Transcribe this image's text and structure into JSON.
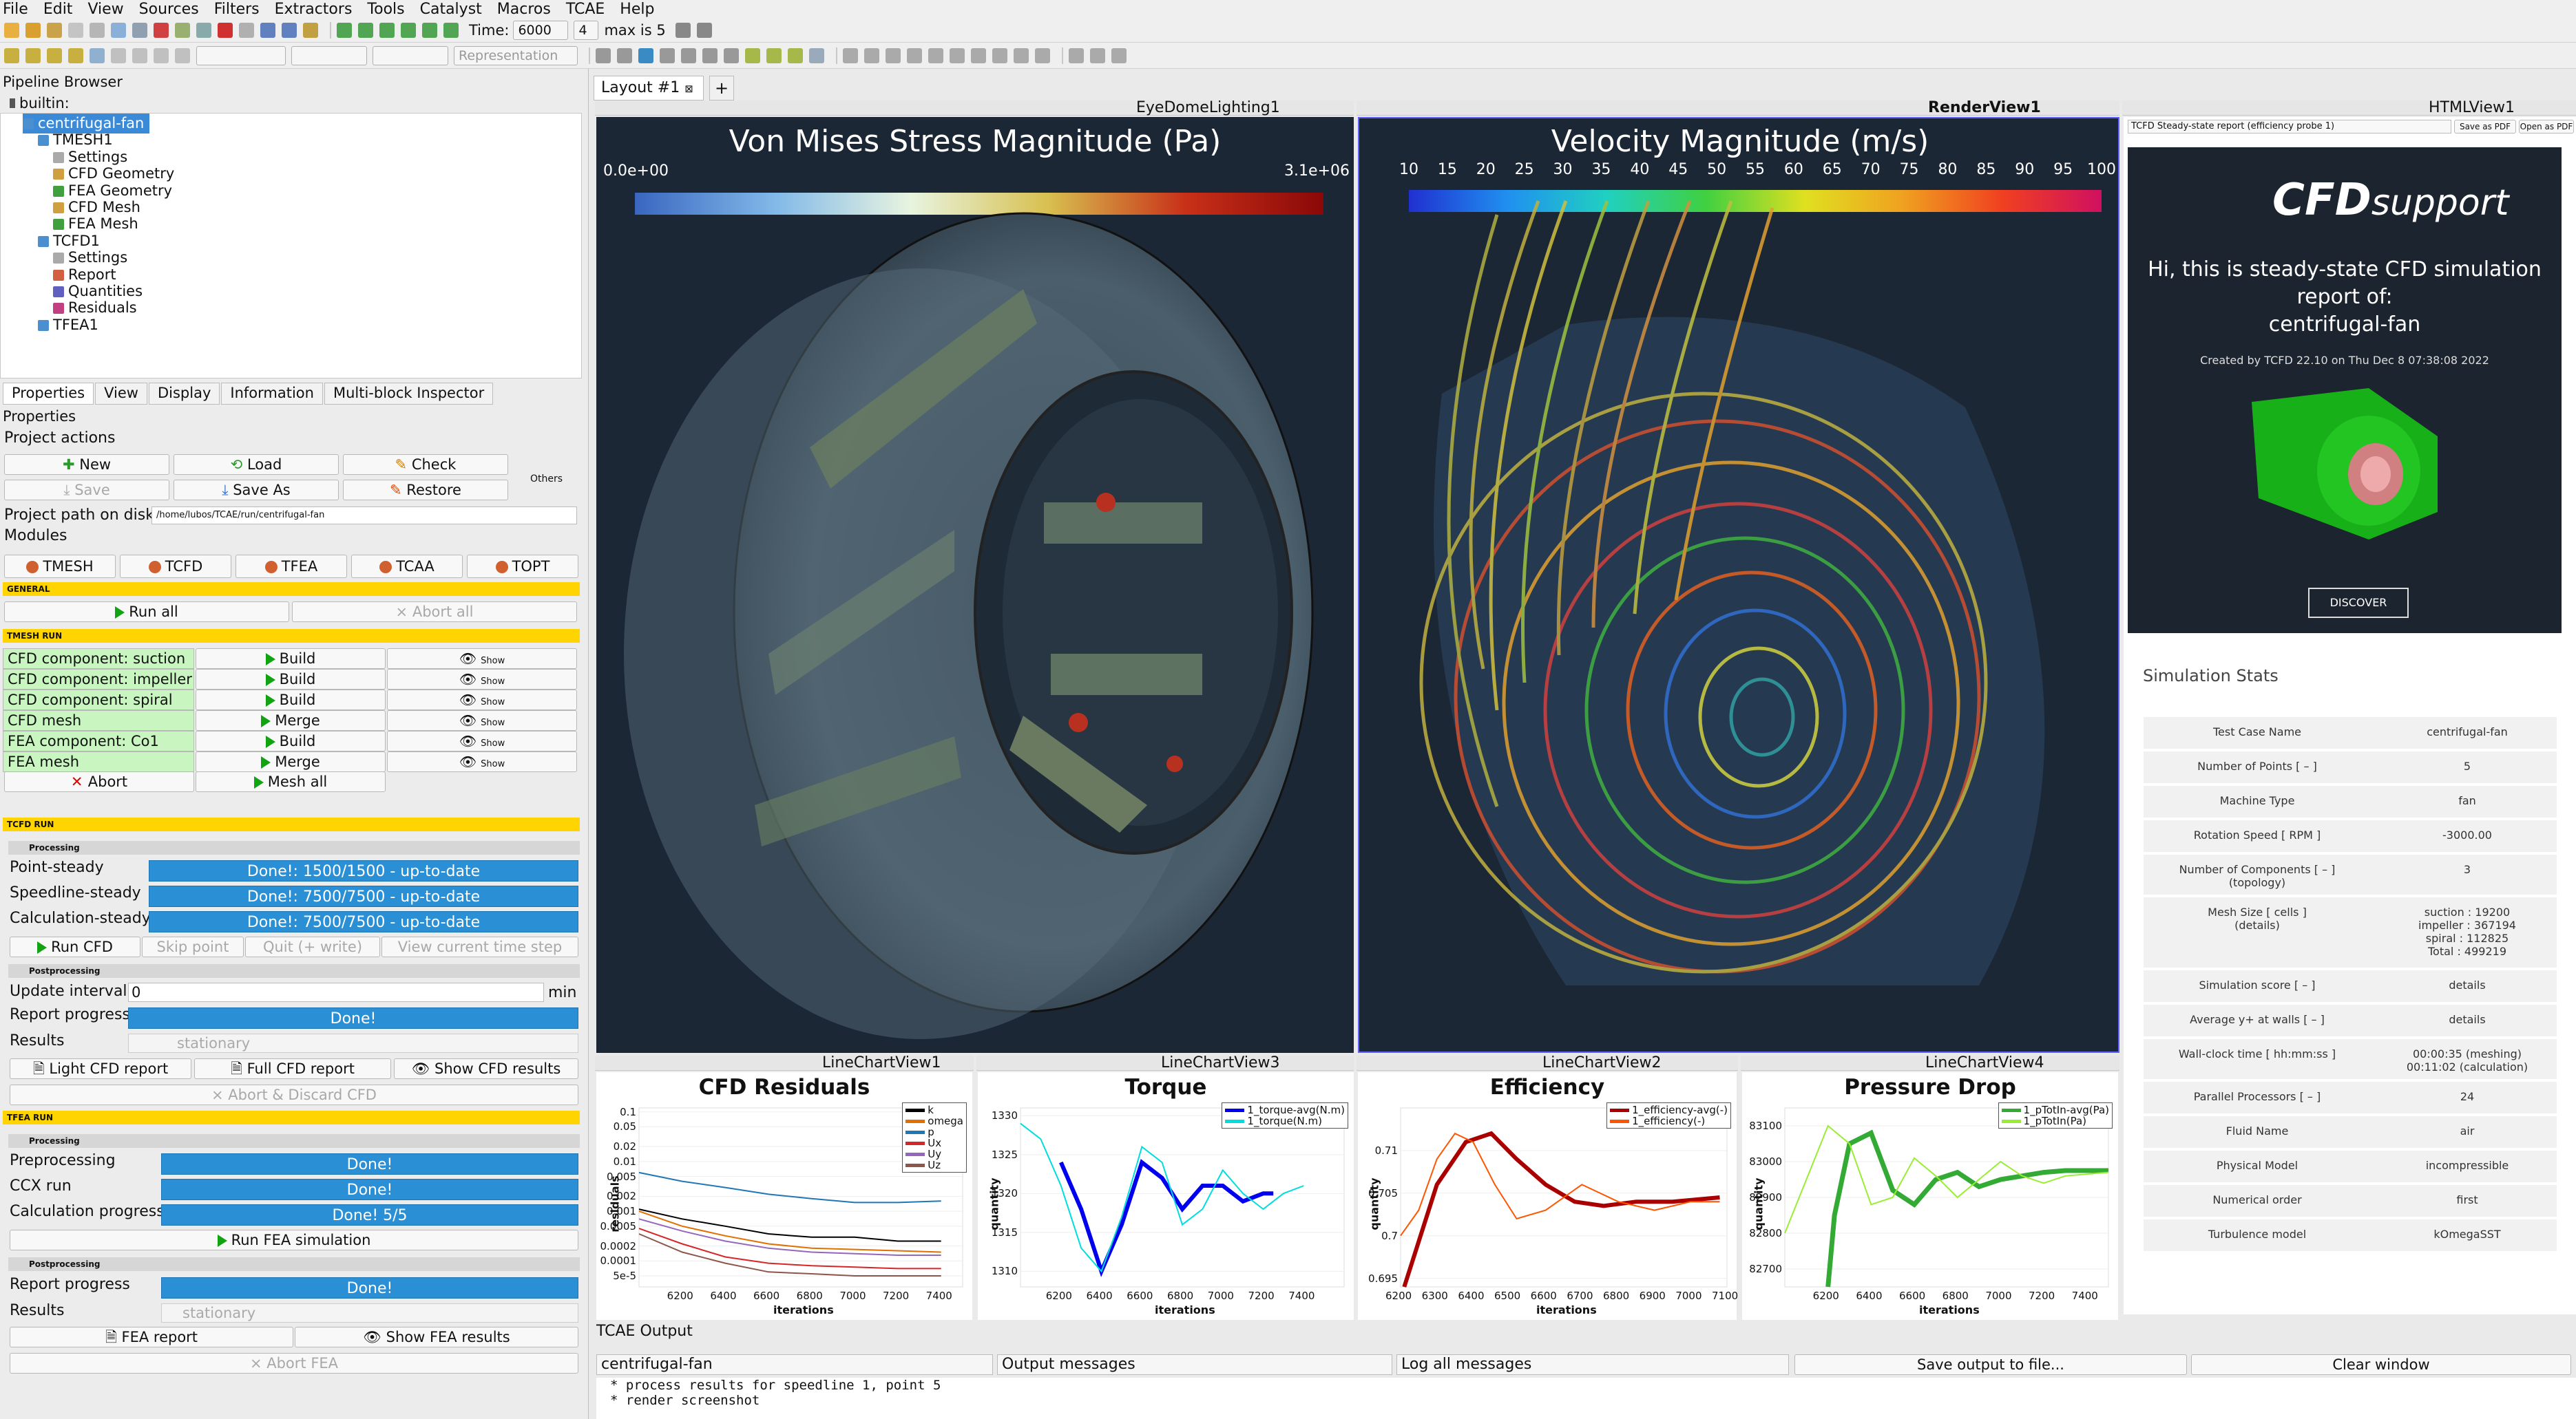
{
  "menu": [
    "File",
    "Edit",
    "View",
    "Sources",
    "Filters",
    "Extractors",
    "Tools",
    "Catalyst",
    "Macros",
    "TCAE",
    "Help"
  ],
  "toolbar": {
    "time_label": "Time:",
    "time_value": "6000",
    "step_value": "4",
    "max_text": "max is 5",
    "representation": "Representation"
  },
  "pipeline": {
    "title": "Pipeline Browser",
    "root": "builtin:",
    "items": [
      {
        "label": "centrifugal-fan",
        "indent": 1,
        "sel": true
      },
      {
        "label": "TMESH1",
        "indent": 2
      },
      {
        "label": "Settings",
        "indent": 3
      },
      {
        "label": "CFD Geometry",
        "indent": 3
      },
      {
        "label": "FEA Geometry",
        "indent": 3
      },
      {
        "label": "CFD Mesh",
        "indent": 3
      },
      {
        "label": "FEA Mesh",
        "indent": 3
      },
      {
        "label": "TCFD1",
        "indent": 2
      },
      {
        "label": "Settings",
        "indent": 3
      },
      {
        "label": "Report",
        "indent": 3
      },
      {
        "label": "Quantities",
        "indent": 3
      },
      {
        "label": "Residuals",
        "indent": 3
      },
      {
        "label": "TFEA1",
        "indent": 2
      }
    ]
  },
  "proptabs": [
    "Properties",
    "View",
    "Display",
    "Information",
    "Multi-block Inspector"
  ],
  "props": {
    "title": "Properties",
    "project_actions": "Project actions",
    "new": "New",
    "load": "Load",
    "check": "Check",
    "save": "Save",
    "save_as": "Save As",
    "restore": "Restore",
    "others": "Others",
    "path_label": "Project path on disk",
    "path_value": "/home/lubos/TCAE/run/centrifugal-fan",
    "modules_label": "Modules",
    "modules": [
      "TMESH",
      "TCFD",
      "TFEA",
      "TCAA",
      "TOPT"
    ],
    "general": "GENERAL",
    "run_all": "Run all",
    "abort_all": "Abort all",
    "tmesh_run": "TMESH RUN",
    "tmesh_rows": [
      {
        "label": "CFD component: suction",
        "action": "Build",
        "show": "Show"
      },
      {
        "label": "CFD component: impeller",
        "action": "Build",
        "show": "Show"
      },
      {
        "label": "CFD component: spiral",
        "action": "Build",
        "show": "Show"
      },
      {
        "label": "CFD mesh",
        "action": "Merge",
        "show": "Show"
      },
      {
        "label": "FEA component: Co1",
        "action": "Build",
        "show": "Show"
      },
      {
        "label": "FEA mesh",
        "action": "Merge",
        "show": "Show"
      }
    ],
    "abort": "Abort",
    "mesh_all": "Mesh all",
    "tcfd_run": "TCFD RUN",
    "processing": "Processing",
    "cfd_progress": [
      {
        "label": "Point-steady",
        "value": "Done!: 1500/1500 - up-to-date"
      },
      {
        "label": "Speedline-steady",
        "value": "Done!: 7500/7500 - up-to-date"
      },
      {
        "label": "Calculation-steady",
        "value": "Done!: 7500/7500 - up-to-date"
      }
    ],
    "run_cfd": "Run CFD",
    "skip_point": "Skip point",
    "quit_write": "Quit (+ write)",
    "view_time_step": "View current time step",
    "postprocessing": "Postprocessing",
    "update_interval": "Update interval",
    "update_value": "0",
    "update_unit": "min",
    "report_progress": "Report progress",
    "done": "Done!",
    "results": "Results",
    "results_value": "stationary",
    "light_cfd": "Light CFD report",
    "full_cfd": "Full CFD report",
    "show_cfd": "Show CFD results",
    "abort_discard": "Abort & Discard CFD",
    "tfea_run": "TFEA RUN",
    "fea_rows": [
      {
        "label": "Preprocessing",
        "value": "Done!"
      },
      {
        "label": "CCX run",
        "value": "Done!"
      },
      {
        "label": "Calculation progress",
        "value": "Done! 5/5"
      }
    ],
    "run_fea": "Run FEA simulation",
    "fea_report": "FEA report",
    "show_fea": "Show FEA results",
    "abort_fea": "Abort FEA"
  },
  "layout_tab": "Layout #1",
  "views": {
    "v1": "EyeDomeLighting1",
    "v2": "RenderView1",
    "v3": "HTMLView1",
    "l1": "LineChartView1",
    "l3": "LineChartView3",
    "l2": "LineChartView2",
    "l4": "LineChartView4"
  },
  "stress": {
    "title": "Von Mises Stress Magnitude (Pa)",
    "min": "0.0e+00",
    "max": "3.1e+06"
  },
  "velocity": {
    "title": "Velocity Magnitude (m/s)",
    "ticks": [
      "10",
      "15",
      "20",
      "25",
      "30",
      "35",
      "40",
      "45",
      "50",
      "55",
      "60",
      "65",
      "70",
      "75",
      "80",
      "85",
      "90",
      "95",
      "100"
    ]
  },
  "html": {
    "select": "TCFD Steady-state report (efficiency probe 1)",
    "save_pdf": "Save as PDF",
    "open_pdf": "Open as PDF",
    "brand": "CFD",
    "brand2": "support",
    "hello": "Hi, this is steady-state CFD simulation",
    "report_of": "report of:",
    "case": "centrifugal-fan",
    "created": "Created by TCFD 22.10 on Thu Dec 8 07:38:08 2022",
    "discover": "DISCOVER",
    "stats_title": "Simulation Stats",
    "stats": [
      [
        "Test Case Name",
        "centrifugal-fan"
      ],
      [
        "Number of Points [ – ]",
        "5"
      ],
      [
        "Machine Type",
        "fan"
      ],
      [
        "Rotation Speed [ RPM ]",
        "-3000.00"
      ],
      [
        "Number of Components [ – ]\n(topology)",
        "3"
      ],
      [
        "Mesh Size [ cells ]\n(details)",
        "suction : 19200\nimpeller : 367194\nspiral : 112825\nTotal : 499219"
      ],
      [
        "Simulation score [ – ]",
        "details"
      ],
      [
        "Average y+ at walls [ – ]",
        "details"
      ],
      [
        "Wall-clock time [ hh:mm:ss ]",
        "00:00:35 (meshing)\n00:11:02 (calculation)"
      ],
      [
        "Parallel Processors [ – ]",
        "24"
      ],
      [
        "Fluid Name",
        "air"
      ],
      [
        "Physical Model",
        "incompressible"
      ],
      [
        "Numerical order",
        "first"
      ],
      [
        "Turbulence model",
        "kOmegaSST"
      ]
    ]
  },
  "output": {
    "title": "TCAE Output",
    "case": "centrifugal-fan",
    "kind": "Output messages",
    "level": "Log all messages",
    "save": "Save output to file...",
    "clear": "Clear window",
    "lines": [
      "* process results for speedline 1, point 5",
      "* render screenshot"
    ]
  },
  "colors": {
    "progress": "#2a8fd4",
    "yellow": "#ffd400",
    "green_row": "#c8f5c0",
    "view_bg": "#1a2330"
  },
  "chart_data": [
    {
      "type": "line",
      "title": "CFD Residuals",
      "xlabel": "iterations",
      "ylabel": "residuals",
      "xlim": [
        6000,
        7500
      ],
      "yscale": "log",
      "xticks": [
        "6200",
        "6400",
        "6600",
        "6800",
        "7000",
        "7200",
        "7400"
      ],
      "yticks": [
        "0.1",
        "0.05",
        "0.02",
        "0.01",
        "0.005",
        "0.002",
        "0.001",
        "0.0005",
        "0.0002",
        "0.0001",
        "5e-5"
      ],
      "series": [
        {
          "name": "k",
          "color": "#000000",
          "values": [
            [
              6000,
              0.0011
            ],
            [
              6200,
              0.0007
            ],
            [
              6400,
              0.0005
            ],
            [
              6600,
              0.00035
            ],
            [
              6800,
              0.0003
            ],
            [
              7000,
              0.0003
            ],
            [
              7200,
              0.00025
            ],
            [
              7400,
              0.00025
            ]
          ]
        },
        {
          "name": "omega",
          "color": "#e07000",
          "values": [
            [
              6000,
              0.001
            ],
            [
              6200,
              0.0005
            ],
            [
              6400,
              0.00032
            ],
            [
              6600,
              0.00022
            ],
            [
              6800,
              0.00018
            ],
            [
              7000,
              0.00017
            ],
            [
              7200,
              0.00016
            ],
            [
              7400,
              0.00015
            ]
          ]
        },
        {
          "name": "p",
          "color": "#1f77b4",
          "values": [
            [
              6000,
              0.006
            ],
            [
              6200,
              0.004
            ],
            [
              6400,
              0.003
            ],
            [
              6600,
              0.0022
            ],
            [
              6800,
              0.0018
            ],
            [
              7000,
              0.0015
            ],
            [
              7200,
              0.0015
            ],
            [
              7400,
              0.0016
            ]
          ]
        },
        {
          "name": "Ux",
          "color": "#d62728",
          "values": [
            [
              6000,
              0.00045
            ],
            [
              6200,
              0.00022
            ],
            [
              6400,
              0.00012
            ],
            [
              6600,
              9e-05
            ],
            [
              6800,
              8e-05
            ],
            [
              7000,
              7.5e-05
            ],
            [
              7200,
              7e-05
            ],
            [
              7400,
              7e-05
            ]
          ]
        },
        {
          "name": "Uy",
          "color": "#9467bd",
          "values": [
            [
              6000,
              0.0007
            ],
            [
              6200,
              0.0004
            ],
            [
              6400,
              0.00025
            ],
            [
              6600,
              0.00018
            ],
            [
              6800,
              0.00015
            ],
            [
              7000,
              0.00014
            ],
            [
              7200,
              0.00013
            ],
            [
              7400,
              0.00013
            ]
          ]
        },
        {
          "name": "Uz",
          "color": "#8c564b",
          "values": [
            [
              6000,
              0.00035
            ],
            [
              6200,
              0.00015
            ],
            [
              6400,
              9e-05
            ],
            [
              6600,
              6e-05
            ],
            [
              6800,
              5.5e-05
            ],
            [
              7000,
              5e-05
            ],
            [
              7200,
              5e-05
            ],
            [
              7400,
              5e-05
            ]
          ]
        }
      ]
    },
    {
      "type": "line",
      "title": "Torque",
      "xlabel": "iterations",
      "ylabel": "quantity",
      "xlim": [
        6000,
        7600
      ],
      "ylim": [
        1308,
        1331
      ],
      "xticks": [
        "6200",
        "6400",
        "6600",
        "6800",
        "7000",
        "7200",
        "7400"
      ],
      "yticks": [
        "1330",
        "1325",
        "1320",
        "1315",
        "1310"
      ],
      "series": [
        {
          "name": "1_torque-avg(N.m)",
          "color": "#0000ee",
          "width": 6,
          "values": [
            [
              6200,
              1324
            ],
            [
              6300,
              1318
            ],
            [
              6400,
              1310
            ],
            [
              6500,
              1316
            ],
            [
              6600,
              1324
            ],
            [
              6700,
              1322
            ],
            [
              6800,
              1318
            ],
            [
              6900,
              1321
            ],
            [
              7000,
              1321
            ],
            [
              7100,
              1319
            ],
            [
              7200,
              1320
            ],
            [
              7250,
              1320
            ]
          ]
        },
        {
          "name": "1_torque(N.m)",
          "color": "#00dddd",
          "width": 2,
          "values": [
            [
              6000,
              1329
            ],
            [
              6100,
              1327
            ],
            [
              6200,
              1321
            ],
            [
              6300,
              1313
            ],
            [
              6400,
              1310
            ],
            [
              6500,
              1317
            ],
            [
              6600,
              1326
            ],
            [
              6700,
              1324
            ],
            [
              6800,
              1316
            ],
            [
              6900,
              1318
            ],
            [
              7000,
              1323
            ],
            [
              7100,
              1320
            ],
            [
              7200,
              1318
            ],
            [
              7300,
              1320
            ],
            [
              7400,
              1321
            ]
          ]
        }
      ]
    },
    {
      "type": "line",
      "title": "Efficiency",
      "xlabel": "iterations",
      "ylabel": "quantity",
      "xlim": [
        6200,
        7100
      ],
      "ylim": [
        0.694,
        0.715
      ],
      "xticks": [
        "6200",
        "6300",
        "6400",
        "6500",
        "6600",
        "6700",
        "6800",
        "6900",
        "7000",
        "7100"
      ],
      "yticks": [
        "0.71",
        "0.705",
        "0.7",
        "0.695"
      ],
      "series": [
        {
          "name": "1_efficiency-avg(-)",
          "color": "#aa0000",
          "width": 6,
          "values": [
            [
              6210,
              0.694
            ],
            [
              6240,
              0.698
            ],
            [
              6300,
              0.706
            ],
            [
              6380,
              0.711
            ],
            [
              6450,
              0.712
            ],
            [
              6520,
              0.709
            ],
            [
              6600,
              0.706
            ],
            [
              6680,
              0.704
            ],
            [
              6760,
              0.7035
            ],
            [
              6850,
              0.704
            ],
            [
              6950,
              0.704
            ],
            [
              7080,
              0.7045
            ]
          ]
        },
        {
          "name": "1_efficiency(-)",
          "color": "#ff5500",
          "width": 2,
          "values": [
            [
              6200,
              0.7
            ],
            [
              6250,
              0.703
            ],
            [
              6300,
              0.709
            ],
            [
              6350,
              0.712
            ],
            [
              6400,
              0.711
            ],
            [
              6460,
              0.706
            ],
            [
              6520,
              0.702
            ],
            [
              6600,
              0.703
            ],
            [
              6700,
              0.706
            ],
            [
              6800,
              0.704
            ],
            [
              6900,
              0.703
            ],
            [
              7000,
              0.704
            ],
            [
              7080,
              0.704
            ]
          ]
        }
      ]
    },
    {
      "type": "line",
      "title": "Pressure Drop",
      "xlabel": "iterations",
      "ylabel": "quantity",
      "xlim": [
        6000,
        7500
      ],
      "ylim": [
        82650,
        83150
      ],
      "xticks": [
        "6200",
        "6400",
        "6600",
        "6800",
        "7000",
        "7200",
        "7400"
      ],
      "yticks": [
        "83100",
        "83000",
        "82900",
        "82800",
        "82700"
      ],
      "series": [
        {
          "name": "1_pTotIn-avg(Pa)",
          "color": "#33aa33",
          "width": 7,
          "values": [
            [
              6200,
              82650
            ],
            [
              6230,
              82850
            ],
            [
              6300,
              83050
            ],
            [
              6400,
              83080
            ],
            [
              6500,
              82920
            ],
            [
              6600,
              82880
            ],
            [
              6700,
              82950
            ],
            [
              6800,
              82970
            ],
            [
              6900,
              82930
            ],
            [
              7000,
              82950
            ],
            [
              7100,
              82960
            ],
            [
              7200,
              82970
            ],
            [
              7300,
              82975
            ],
            [
              7500,
              82975
            ]
          ]
        },
        {
          "name": "1_pTotIn(Pa)",
          "color": "#99ee33",
          "width": 2,
          "values": [
            [
              6000,
              82800
            ],
            [
              6100,
              82950
            ],
            [
              6200,
              83100
            ],
            [
              6300,
              83050
            ],
            [
              6400,
              82880
            ],
            [
              6500,
              82900
            ],
            [
              6600,
              83010
            ],
            [
              6700,
              82960
            ],
            [
              6800,
              82900
            ],
            [
              6900,
              82950
            ],
            [
              7000,
              83000
            ],
            [
              7100,
              82960
            ],
            [
              7200,
              82940
            ],
            [
              7300,
              82960
            ],
            [
              7500,
              82970
            ]
          ]
        }
      ]
    }
  ]
}
